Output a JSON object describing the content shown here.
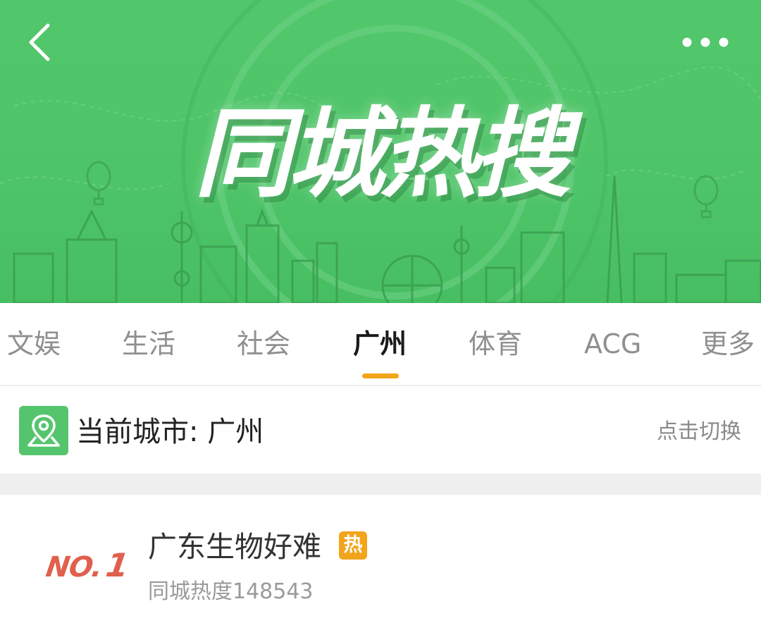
{
  "banner": {
    "title": "同城热搜",
    "back_icon": "chevron-left-icon",
    "more_icon": "more-horizontal-icon",
    "background_color": "#4ec468"
  },
  "tabs": [
    {
      "label": "文娱",
      "active": false
    },
    {
      "label": "生活",
      "active": false
    },
    {
      "label": "社会",
      "active": false
    },
    {
      "label": "广州",
      "active": true
    },
    {
      "label": "体育",
      "active": false
    },
    {
      "label": "ACG",
      "active": false
    },
    {
      "label": "更多",
      "active": false
    }
  ],
  "tab_indicator_color": "#f2a517",
  "city": {
    "icon": "location-pin-icon",
    "label": "当前城市: 广州",
    "switch_label": "点击切换"
  },
  "list": [
    {
      "rank_prefix": "NO.",
      "rank": "1",
      "title": "广东生物好难",
      "badge": "热",
      "heat": "同城热度148543"
    }
  ]
}
